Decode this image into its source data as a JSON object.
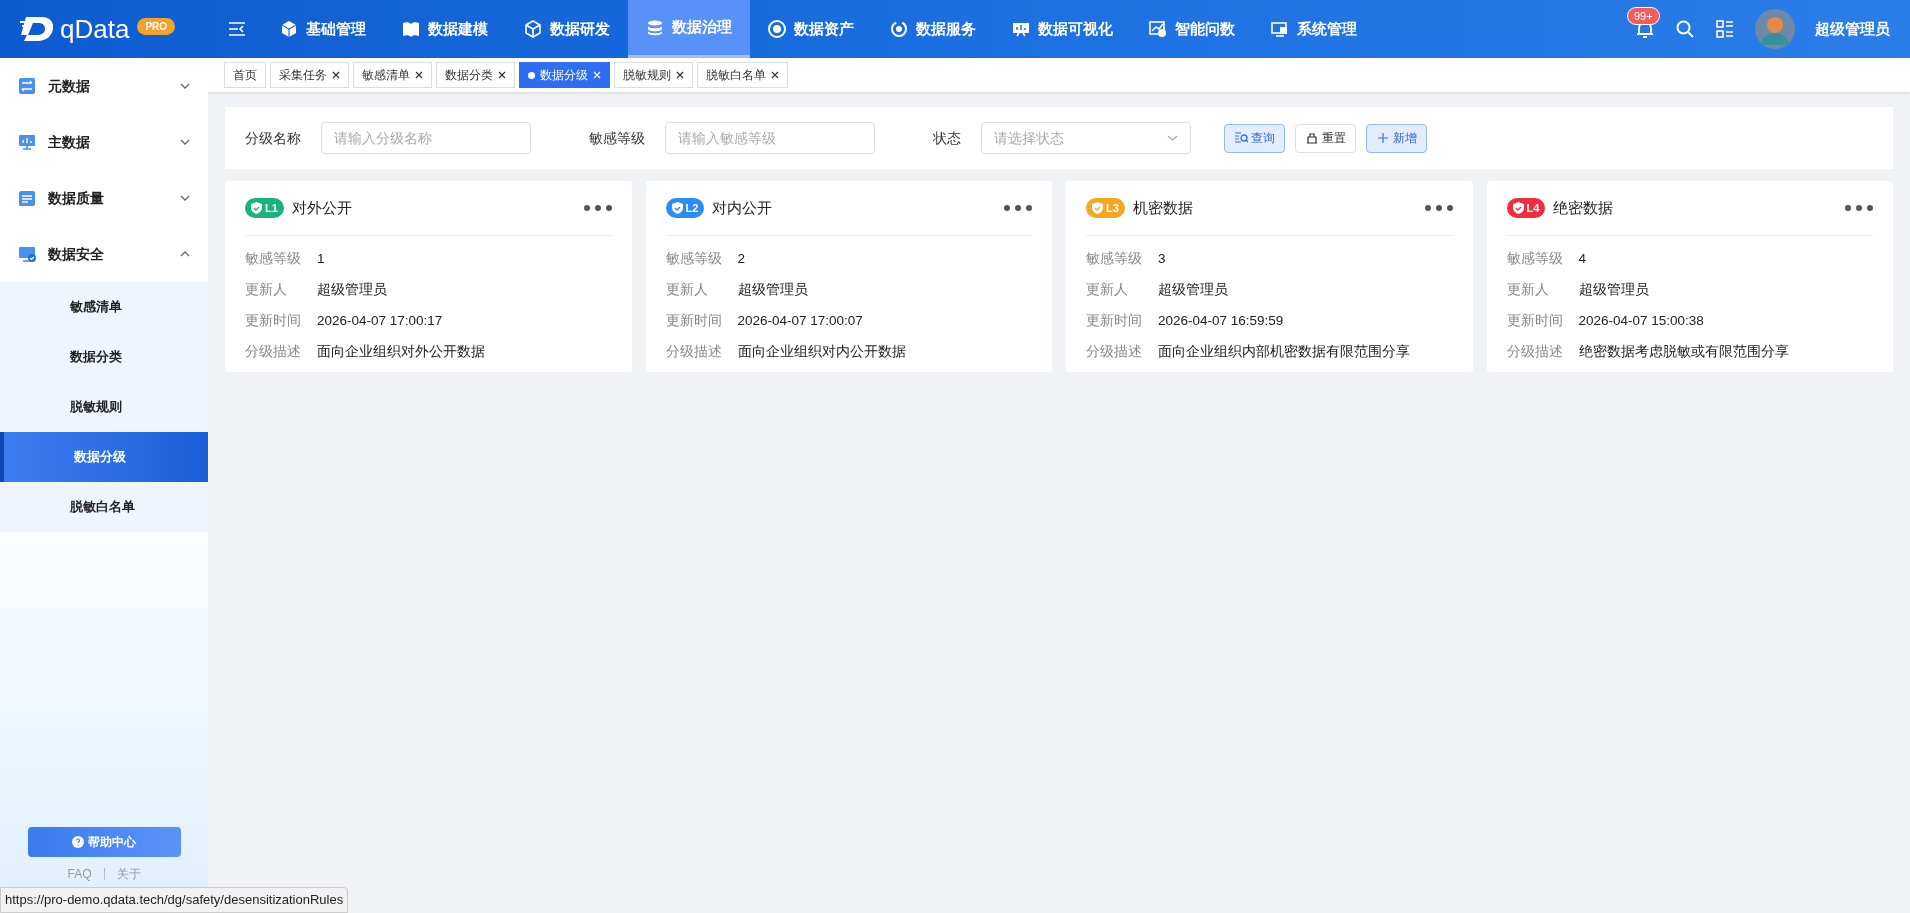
{
  "logo": {
    "name": "qData",
    "badge": "PRO"
  },
  "nav": [
    {
      "label": "基础管理",
      "selected": false
    },
    {
      "label": "数据建模",
      "selected": false
    },
    {
      "label": "数据研发",
      "selected": false
    },
    {
      "label": "数据治理",
      "selected": true
    },
    {
      "label": "数据资产",
      "selected": false
    },
    {
      "label": "数据服务",
      "selected": false
    },
    {
      "label": "数据可视化",
      "selected": false
    },
    {
      "label": "智能问数",
      "selected": false
    },
    {
      "label": "系统管理",
      "selected": false
    }
  ],
  "notifications": {
    "count": "99+"
  },
  "user": {
    "name": "超级管理员"
  },
  "sidebar": {
    "items": [
      {
        "label": "元数据",
        "expanded": false
      },
      {
        "label": "主数据",
        "expanded": false
      },
      {
        "label": "数据质量",
        "expanded": false
      },
      {
        "label": "数据安全",
        "expanded": true,
        "children": [
          {
            "label": "敏感清单",
            "selected": false
          },
          {
            "label": "数据分类",
            "selected": false
          },
          {
            "label": "脱敏规则",
            "selected": false
          },
          {
            "label": "数据分级",
            "selected": true
          },
          {
            "label": "脱敏白名单",
            "selected": false
          }
        ]
      }
    ],
    "help": "帮助中心",
    "links": [
      "FAQ",
      "关于"
    ]
  },
  "tabs": [
    {
      "label": "首页",
      "selected": false,
      "closable": false
    },
    {
      "label": "采集任务",
      "selected": false,
      "closable": true
    },
    {
      "label": "敏感清单",
      "selected": false,
      "closable": true
    },
    {
      "label": "数据分类",
      "selected": false,
      "closable": true
    },
    {
      "label": "数据分级",
      "selected": true,
      "closable": true
    },
    {
      "label": "脱敏规则",
      "selected": false,
      "closable": true
    },
    {
      "label": "脱敏白名单",
      "selected": false,
      "closable": true
    }
  ],
  "filters": [
    {
      "label": "分级名称",
      "placeholder": "请输入分级名称",
      "kind": "input"
    },
    {
      "label": "敏感等级",
      "placeholder": "请输入敏感等级",
      "kind": "input"
    },
    {
      "label": "状态",
      "placeholder": "请选择状态",
      "kind": "select"
    }
  ],
  "buttons": [
    {
      "label": "查询",
      "kind": "search"
    },
    {
      "label": "重置",
      "kind": "reset"
    },
    {
      "label": "新增",
      "kind": "add"
    }
  ],
  "cards": [
    {
      "badge": "L1",
      "color": "#19b37b",
      "title": "对外公开",
      "fields": [
        {
          "label": "敏感等级",
          "value": "1"
        },
        {
          "label": "更新人",
          "value": "超级管理员"
        },
        {
          "label": "更新时间",
          "value": "2026-04-07 17:00:17"
        },
        {
          "label": "分级描述",
          "value": "面向企业组织对外公开数据"
        }
      ]
    },
    {
      "badge": "L2",
      "color": "#2b8cf5",
      "title": "对内公开",
      "fields": [
        {
          "label": "敏感等级",
          "value": "2"
        },
        {
          "label": "更新人",
          "value": "超级管理员"
        },
        {
          "label": "更新时间",
          "value": "2026-04-07 17:00:07"
        },
        {
          "label": "分级描述",
          "value": "面向企业组织对内公开数据"
        }
      ]
    },
    {
      "badge": "L3",
      "color": "#f5a623",
      "title": "机密数据",
      "fields": [
        {
          "label": "敏感等级",
          "value": "3"
        },
        {
          "label": "更新人",
          "value": "超级管理员"
        },
        {
          "label": "更新时间",
          "value": "2026-04-07 16:59:59"
        },
        {
          "label": "分级描述",
          "value": "面向企业组织内部机密数据有限范围分享"
        }
      ]
    },
    {
      "badge": "L4",
      "color": "#ee2e3c",
      "title": "绝密数据",
      "fields": [
        {
          "label": "敏感等级",
          "value": "4"
        },
        {
          "label": "更新人",
          "value": "超级管理员"
        },
        {
          "label": "更新时间",
          "value": "2026-04-07 15:00:38"
        },
        {
          "label": "分级描述",
          "value": "绝密数据考虑脱敏或有限范围分享"
        }
      ]
    }
  ],
  "status_url": "https://pro-demo.qdata.tech/dg/safety/desensitizationRules"
}
